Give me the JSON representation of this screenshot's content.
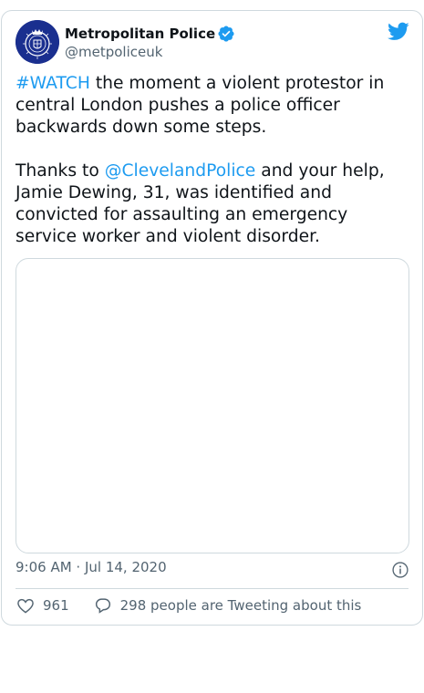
{
  "author": {
    "name": "Metropolitan Police",
    "handle": "@metpoliceuk",
    "verified": true,
    "avatar_icon": "met-police-crest-icon"
  },
  "tweet": {
    "hashtag": "#WATCH",
    "line1_rest": " the moment a violent protestor in central London pushes a police officer backwards down some steps.",
    "line2_prefix": "Thanks to ",
    "mention": "@ClevelandPolice",
    "line2_rest": " and your help, Jamie Dewing, 31, was identified and convicted for assaulting an emergency service worker and violent disorder."
  },
  "timestamp": "9:06 AM · Jul 14, 2020",
  "actions": {
    "like_count": "961",
    "reply_text": "298 people are Tweeting about this"
  },
  "colors": {
    "link": "#1d9bf0",
    "secondary_text": "#536471",
    "border": "#cfd9de",
    "avatar_bg": "#1a2f8f"
  }
}
